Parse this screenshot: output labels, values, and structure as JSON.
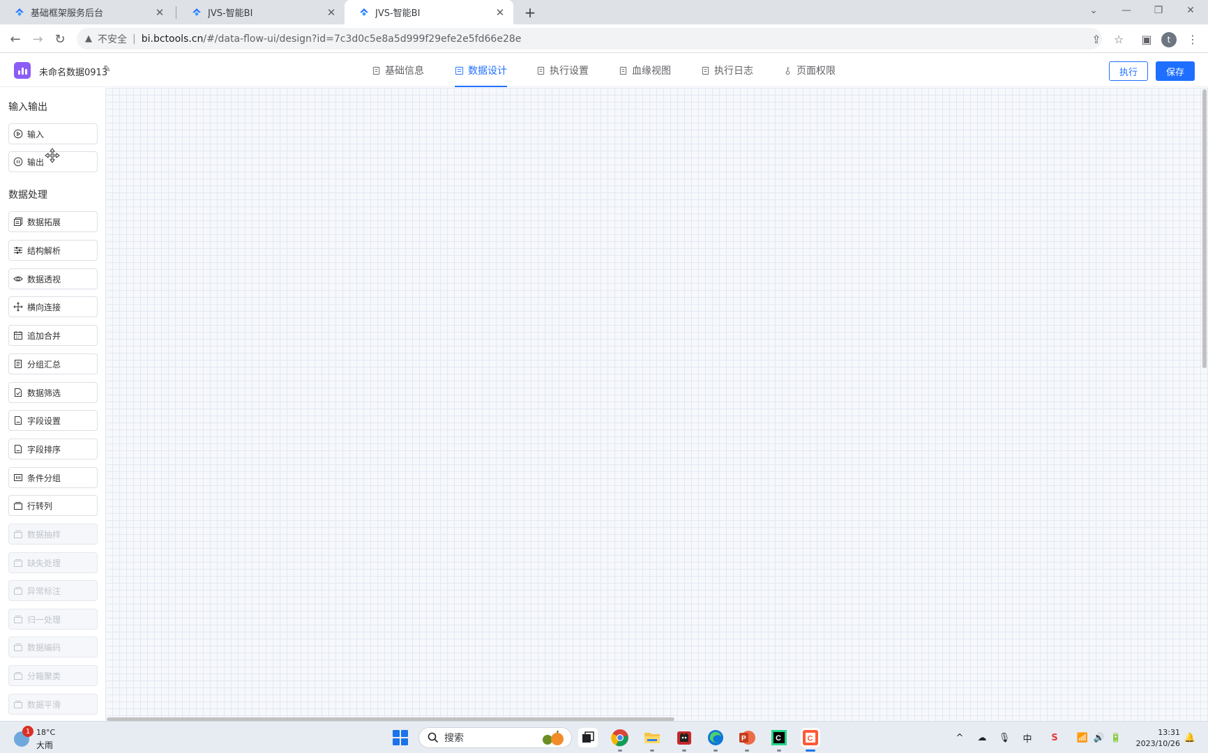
{
  "browser": {
    "tabs": [
      {
        "title": "基础框架服务后台",
        "active": false
      },
      {
        "title": "JVS-智能BI",
        "active": false
      },
      {
        "title": "JVS-智能BI",
        "active": true
      }
    ],
    "address": {
      "security_label": "不安全",
      "host": "bi.bctools.cn",
      "path": "/#/data-flow-ui/design?id=7c3d0c5e8a5d999f29efe2e5fd66e28e"
    },
    "profile_initial": "t"
  },
  "app": {
    "name": "未命名数据0913",
    "nav_tabs": [
      {
        "label": "基础信息",
        "active": false
      },
      {
        "label": "数据设计",
        "active": true
      },
      {
        "label": "执行设置",
        "active": false
      },
      {
        "label": "血缘视图",
        "active": false
      },
      {
        "label": "执行日志",
        "active": false
      },
      {
        "label": "页面权限",
        "active": false
      }
    ],
    "run_label": "执行",
    "save_label": "保存",
    "accent_color": "#1e6fff"
  },
  "sidebar": {
    "io_title": "输入输出",
    "io_items": [
      {
        "label": "输入",
        "icon": "play-circle-icon"
      },
      {
        "label": "输出",
        "icon": "pause-circle-icon"
      }
    ],
    "processing_title": "数据处理",
    "processing_items": [
      {
        "label": "数据拓展",
        "icon": "copy-icon",
        "disabled": false
      },
      {
        "label": "结构解析",
        "icon": "sliders-icon",
        "disabled": false
      },
      {
        "label": "数据透视",
        "icon": "eye-icon",
        "disabled": false
      },
      {
        "label": "横向连接",
        "icon": "move-icon",
        "disabled": false
      },
      {
        "label": "追加合并",
        "icon": "calendar-icon",
        "disabled": false
      },
      {
        "label": "分组汇总",
        "icon": "document-icon",
        "disabled": false
      },
      {
        "label": "数据筛选",
        "icon": "document-check-icon",
        "disabled": false
      },
      {
        "label": "字段设置",
        "icon": "document-icon",
        "disabled": false
      },
      {
        "label": "字段排序",
        "icon": "document-icon",
        "disabled": false
      },
      {
        "label": "条件分组",
        "icon": "grid-icon",
        "disabled": false
      },
      {
        "label": "行转列",
        "icon": "tray-icon",
        "disabled": false
      },
      {
        "label": "数据抽样",
        "icon": "tray-icon",
        "disabled": true
      },
      {
        "label": "缺失处理",
        "icon": "tray-icon",
        "disabled": true
      },
      {
        "label": "异常标注",
        "icon": "tray-icon",
        "disabled": true
      },
      {
        "label": "归一处理",
        "icon": "tray-icon",
        "disabled": true
      },
      {
        "label": "数据编码",
        "icon": "tray-icon",
        "disabled": true
      },
      {
        "label": "分箱聚类",
        "icon": "tray-icon",
        "disabled": true
      },
      {
        "label": "数据平滑",
        "icon": "tray-icon",
        "disabled": true
      }
    ]
  },
  "taskbar": {
    "weather_badge": "1",
    "temperature": "18°C",
    "weather": "大雨",
    "search_label": "搜索",
    "ime": "中",
    "time": "13:31",
    "date": "2023/10/26"
  }
}
